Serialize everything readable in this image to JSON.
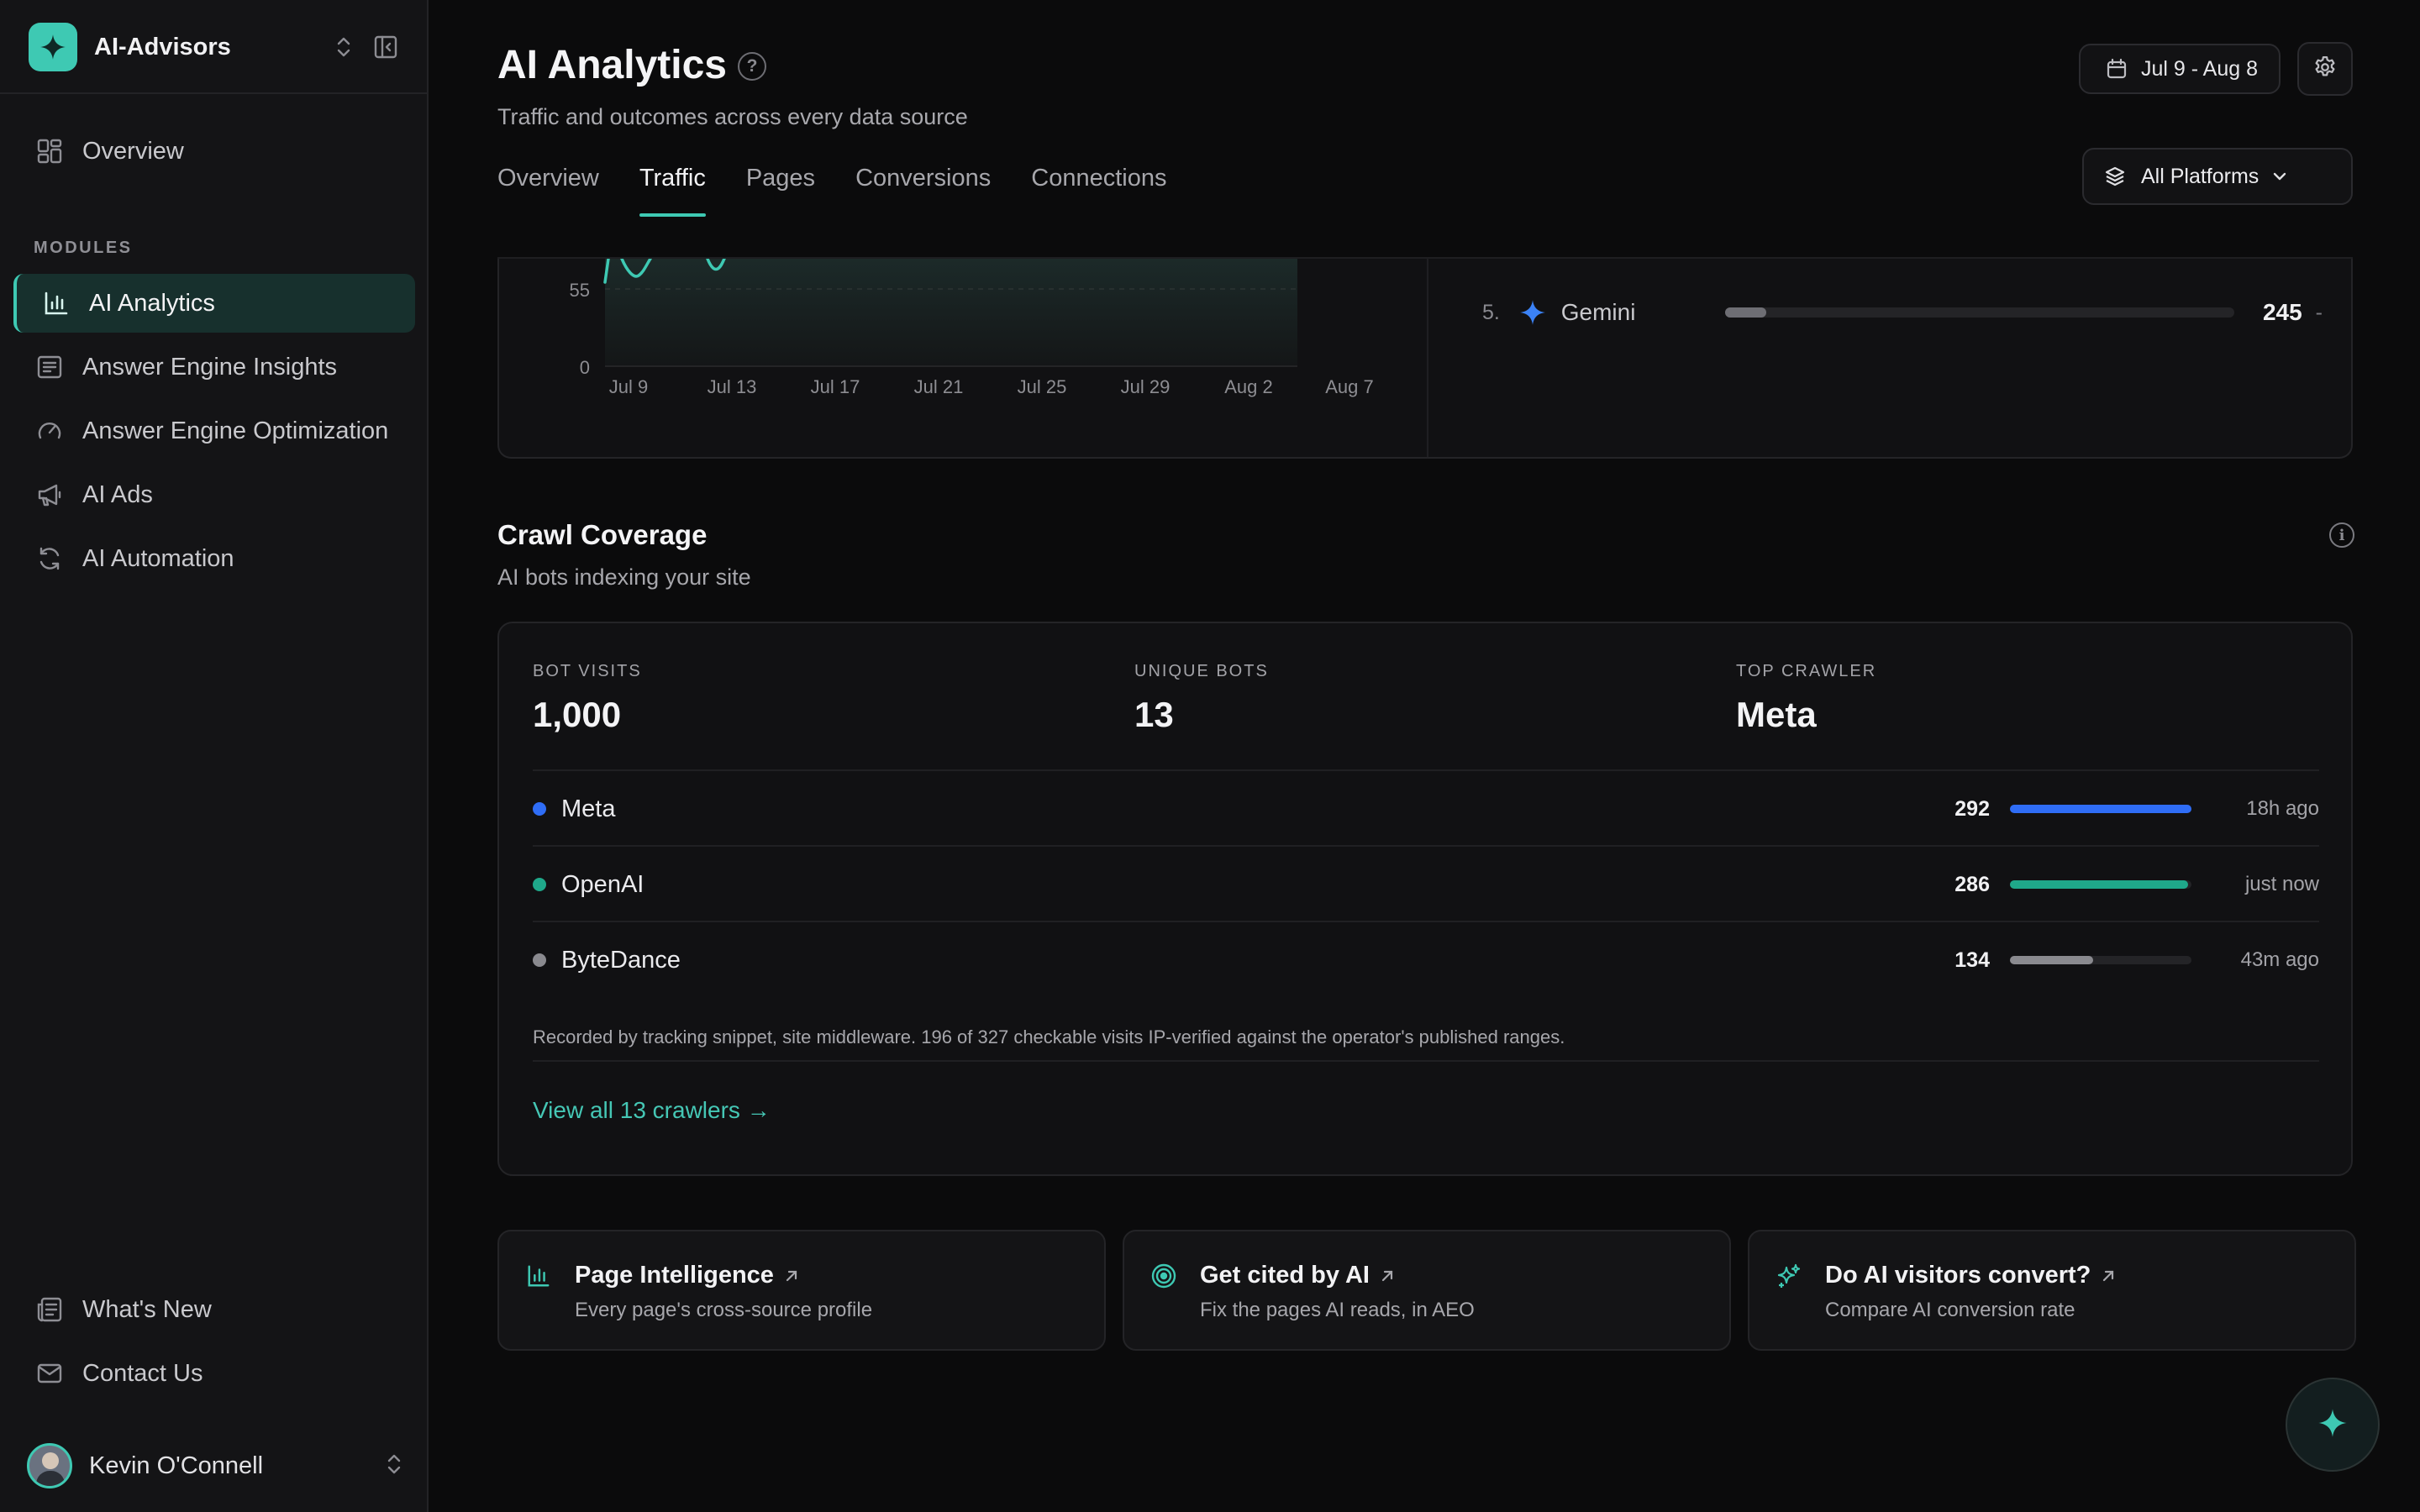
{
  "workspace": {
    "name": "AI-Advisors"
  },
  "sidebar": {
    "overview_label": "Overview",
    "section_label": "MODULES",
    "items": [
      {
        "label": "AI Analytics",
        "icon": "bar-chart-icon",
        "active": true
      },
      {
        "label": "Answer Engine Insights",
        "icon": "document-list-icon"
      },
      {
        "label": "Answer Engine Optimization",
        "icon": "gauge-icon"
      },
      {
        "label": "AI Ads",
        "icon": "megaphone-icon"
      },
      {
        "label": "AI Automation",
        "icon": "refresh-icon"
      }
    ],
    "footer": [
      {
        "label": "What's New",
        "icon": "newspaper-icon"
      },
      {
        "label": "Contact Us",
        "icon": "mail-icon"
      }
    ],
    "user_name": "Kevin O'Connell"
  },
  "header": {
    "title": "AI Analytics",
    "help_glyph": "?",
    "subtitle": "Traffic and outcomes across every data source",
    "date_range": "Jul 9 - Aug 8",
    "platform_filter": "All Platforms",
    "tabs": [
      {
        "label": "Overview"
      },
      {
        "label": "Traffic",
        "active": true
      },
      {
        "label": "Pages"
      },
      {
        "label": "Conversions"
      },
      {
        "label": "Connections"
      }
    ]
  },
  "traffic_chart": {
    "y_ticks": [
      "55",
      "0"
    ],
    "x_ticks": [
      "Jul 9",
      "Jul 13",
      "Jul 17",
      "Jul 21",
      "Jul 25",
      "Jul 29",
      "Aug 2",
      "Aug 7"
    ],
    "line_color": "#3ec9b3"
  },
  "platform_rank": {
    "rank": "5.",
    "name": "Gemini",
    "icon": "gemini-sparkle-icon",
    "value": "245",
    "change": "-",
    "share": 0.08
  },
  "crawl": {
    "title": "Crawl Coverage",
    "subtitle": "AI bots indexing your site",
    "info_glyph": "i",
    "stats": [
      {
        "label": "BOT VISITS",
        "value": "1,000"
      },
      {
        "label": "UNIQUE BOTS",
        "value": "13"
      },
      {
        "label": "TOP CRAWLER",
        "value": "Meta"
      }
    ],
    "bots": [
      {
        "name": "Meta",
        "count": "292",
        "share": 1.0,
        "color": "#2f6df6",
        "last_seen": "18h ago"
      },
      {
        "name": "OpenAI",
        "count": "286",
        "share": 0.98,
        "color": "#1fa88a",
        "last_seen": "just now"
      },
      {
        "name": "ByteDance",
        "count": "134",
        "share": 0.46,
        "color": "#8a8a8f",
        "last_seen": "43m ago"
      }
    ],
    "note": "Recorded by tracking snippet, site middleware. 196 of 327 checkable visits IP-verified against the operator's published ranges.",
    "link": "View all 13 crawlers →"
  },
  "quick_links": [
    {
      "title": "Page Intelligence",
      "subtitle": "Every page's cross-source profile",
      "icon": "bar-chart-icon"
    },
    {
      "title": "Get cited by AI",
      "subtitle": "Fix the pages AI reads, in AEO",
      "icon": "target-icon"
    },
    {
      "title": "Do AI visitors convert?",
      "subtitle": "Compare AI conversion rate",
      "icon": "sparkles-icon"
    }
  ],
  "colors": {
    "accent": "#3ec9b3",
    "background": "#0b0b0c",
    "sidebar": "#141416"
  }
}
